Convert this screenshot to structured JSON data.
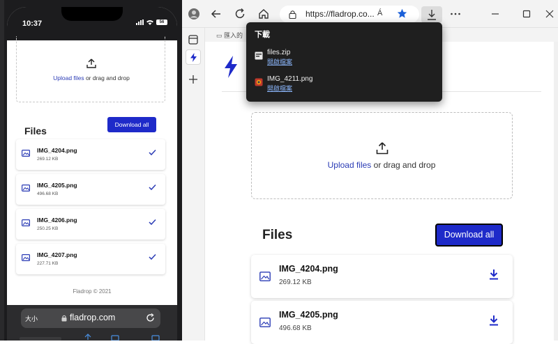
{
  "phone": {
    "time": "10:37",
    "battery": "56",
    "upload_link": "Upload files",
    "upload_rest": " or drag and drop",
    "files_title": "Files",
    "download_all": "Download all",
    "files": [
      {
        "name": "IMG_4204.png",
        "size": "269.12 KB"
      },
      {
        "name": "IMG_4205.png",
        "size": "496.68 KB"
      },
      {
        "name": "IMG_4206.png",
        "size": "250.25 KB"
      },
      {
        "name": "IMG_4207.png",
        "size": "227.71 KB"
      }
    ],
    "footer": "Fladrop © 2021",
    "safari": {
      "text_size": "大小",
      "domain": "fladrop.com"
    }
  },
  "browser": {
    "url": "https://fladrop.co...",
    "read_aloud": "Á",
    "favorites_folder": "匯入的",
    "upload_link": "Upload files",
    "upload_rest": " or drag and drop",
    "files_title": "Files",
    "download_all": "Download all",
    "files": [
      {
        "name": "IMG_4204.png",
        "size": "269.12 KB"
      },
      {
        "name": "IMG_4205.png",
        "size": "496.68 KB"
      }
    ],
    "downloads_panel": {
      "title": "下載",
      "items": [
        {
          "name": "files.zip",
          "action": "開啟檔案"
        },
        {
          "name": "IMG_4211.png",
          "action": "開啟檔案"
        }
      ]
    }
  },
  "colors": {
    "accent": "#1e2ac9",
    "link": "#2a3bb5",
    "panel_bg": "#1f1f1f"
  }
}
